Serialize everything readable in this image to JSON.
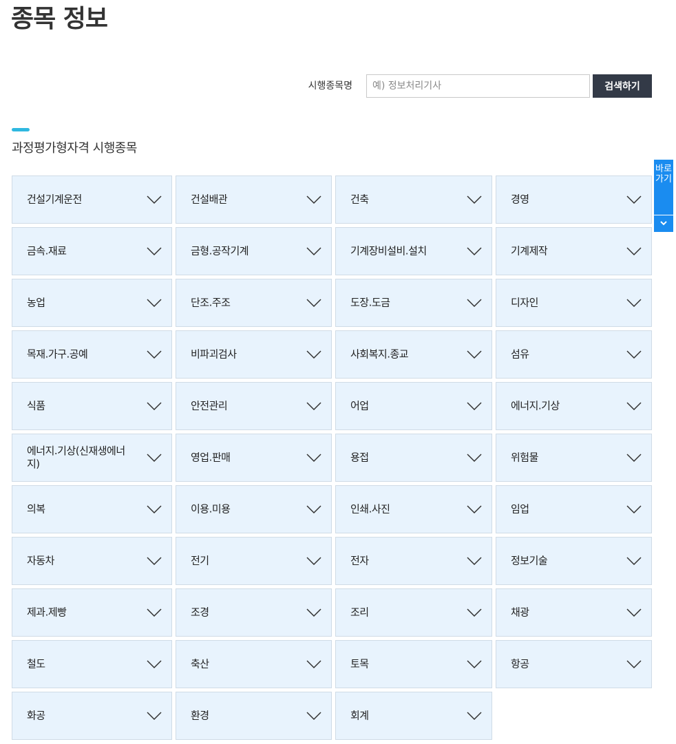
{
  "page": {
    "title": "종목 정보"
  },
  "search": {
    "label": "시행종목명",
    "placeholder": "예) 정보처리기사",
    "value": "",
    "button_label": "검색하기"
  },
  "section": {
    "title": "과정평가형자격 시행종목"
  },
  "quick_nav": {
    "label": "바로가기",
    "icon": "chevron-down-icon"
  },
  "colors": {
    "accent": "#2fb8e0",
    "cell_background": "#e8f3fd",
    "button_dark": "#333a47",
    "quick_nav": "#1a8cf0"
  },
  "categories": [
    "건설기계운전",
    "건설배관",
    "건축",
    "경영",
    "금속.재료",
    "금형.공작기계",
    "기계장비설비.설치",
    "기계제작",
    "농업",
    "단조.주조",
    "도장.도금",
    "디자인",
    "목재.가구.공예",
    "비파괴검사",
    "사회복지.종교",
    "섬유",
    "식품",
    "안전관리",
    "어업",
    "에너지.기상",
    "에너지.기상(신재생에너지)",
    "영업.판매",
    "용접",
    "위험물",
    "의복",
    "이용.미용",
    "인쇄.사진",
    "임업",
    "자동차",
    "전기",
    "전자",
    "정보기술",
    "제과.제빵",
    "조경",
    "조리",
    "채광",
    "철도",
    "축산",
    "토목",
    "항공",
    "화공",
    "환경",
    "회계"
  ]
}
